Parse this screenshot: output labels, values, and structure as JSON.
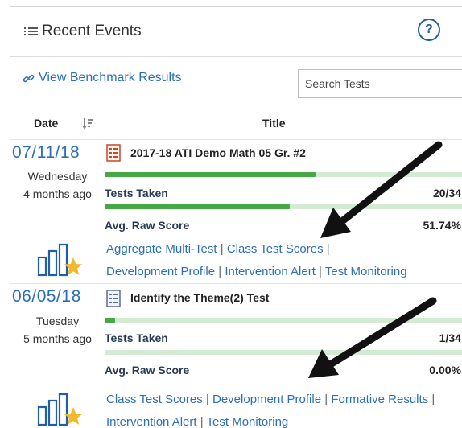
{
  "header": {
    "title": "Recent Events",
    "help_label": "?"
  },
  "toolbar": {
    "benchmark_link": "View Benchmark Results",
    "search_placeholder": "Search Tests"
  },
  "table": {
    "col_date": "Date",
    "col_title": "Title"
  },
  "events": [
    {
      "date": "07/11/18",
      "weekday": "Wednesday",
      "ago": "4 months ago",
      "title": "2017-18 ATI Demo Math 05 Gr. #2",
      "tests_taken_label": "Tests Taken",
      "tests_taken_value": "20/34",
      "avg_label": "Avg. Raw Score",
      "avg_value": "51.74%",
      "tests_taken_progress": 0.588,
      "avg_progress": 0.5174,
      "links": [
        "Aggregate Multi-Test",
        "Class Test Scores",
        "Development Profile",
        "Intervention Alert",
        "Test Monitoring"
      ]
    },
    {
      "date": "06/05/18",
      "weekday": "Tuesday",
      "ago": "5 months ago",
      "title": "Identify the Theme(2) Test",
      "tests_taken_label": "Tests Taken",
      "tests_taken_value": "1/34",
      "avg_label": "Avg. Raw Score",
      "avg_value": "0.00%",
      "tests_taken_progress": 0.029,
      "avg_progress": 0.0,
      "links": [
        "Class Test Scores",
        "Development Profile",
        "Formative Results",
        "Intervention Alert",
        "Test Monitoring"
      ]
    }
  ],
  "colors": {
    "link": "#2d6fb7",
    "bar": "#45a845",
    "bar_track": "#d3ebd3",
    "accent_star": "#f2b82e"
  },
  "icons": [
    "list-icon",
    "help-icon",
    "link-icon",
    "sort-icon",
    "test-document-icon",
    "chart-star-icon",
    "annotation-arrow"
  ]
}
